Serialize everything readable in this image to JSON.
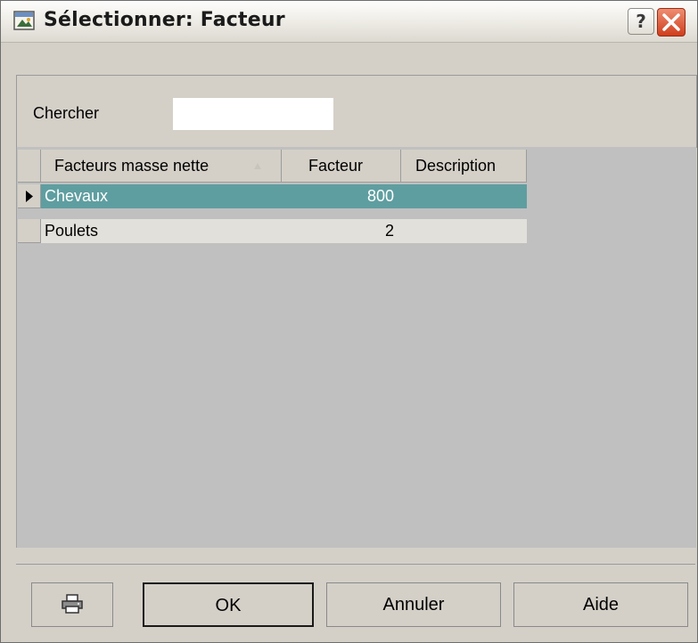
{
  "window": {
    "title": "Sélectionner: Facteur",
    "help_label": "?"
  },
  "search": {
    "label": "Chercher",
    "value": ""
  },
  "grid": {
    "columns": [
      "Facteurs masse nette",
      "Facteur",
      "Description"
    ],
    "rows": [
      {
        "name": "Chevaux",
        "factor": "800",
        "description": "",
        "selected": true
      },
      {
        "name": "Poulets",
        "factor": "2",
        "description": "",
        "selected": false
      }
    ]
  },
  "buttons": {
    "print_icon": "printer-icon",
    "ok": "OK",
    "cancel": "Annuler",
    "help": "Aide"
  },
  "colors": {
    "selection": "#5f9ea0",
    "close_button": "#cf3e1d"
  }
}
